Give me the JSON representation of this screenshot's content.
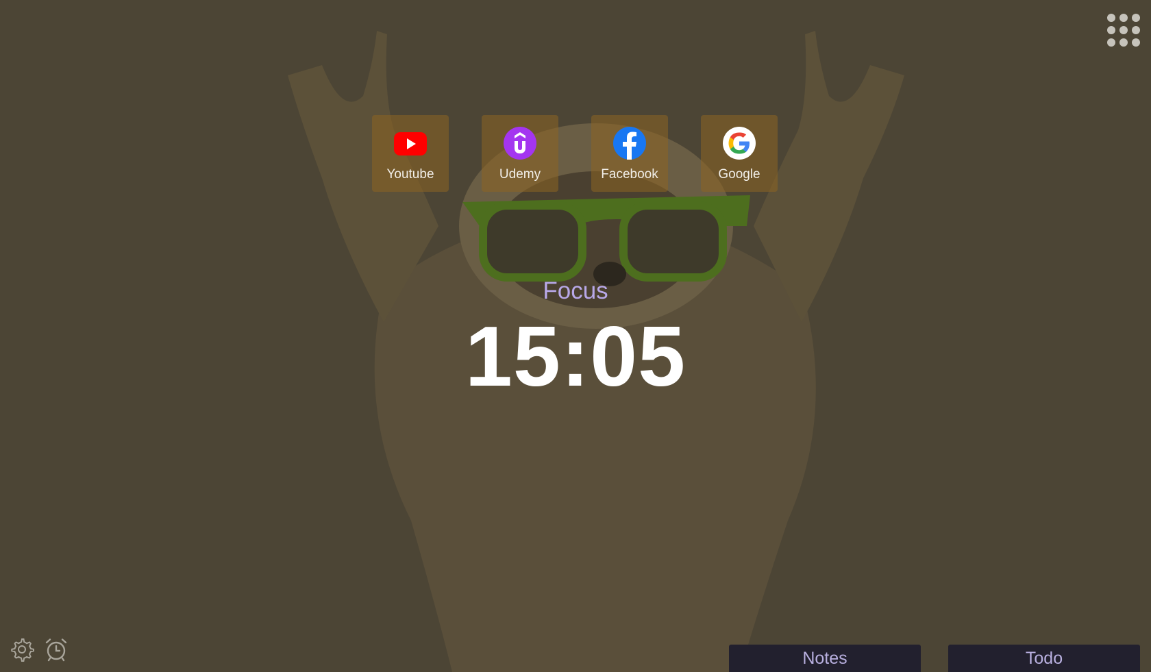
{
  "background": {
    "overlay_color": "#4c4535",
    "subject": "raccoon-with-green-sunglasses"
  },
  "top_right": {
    "icon": "apps-grid-icon"
  },
  "shortcuts": [
    {
      "label": "Youtube",
      "icon": "youtube-icon",
      "color": "#ff0000"
    },
    {
      "label": "Udemy",
      "icon": "udemy-icon",
      "color": "#a435f0"
    },
    {
      "label": "Facebook",
      "icon": "facebook-icon",
      "color": "#1877f2"
    },
    {
      "label": "Google",
      "icon": "google-icon",
      "color": "#4285f4"
    }
  ],
  "timer": {
    "mode": "Focus",
    "time": "15:05",
    "mode_color": "#b8a8e8"
  },
  "bottom_left": {
    "settings_icon": "gear-icon",
    "alarm_icon": "alarm-clock-icon"
  },
  "panels": {
    "notes_label": "Notes",
    "todo_label": "Todo"
  }
}
